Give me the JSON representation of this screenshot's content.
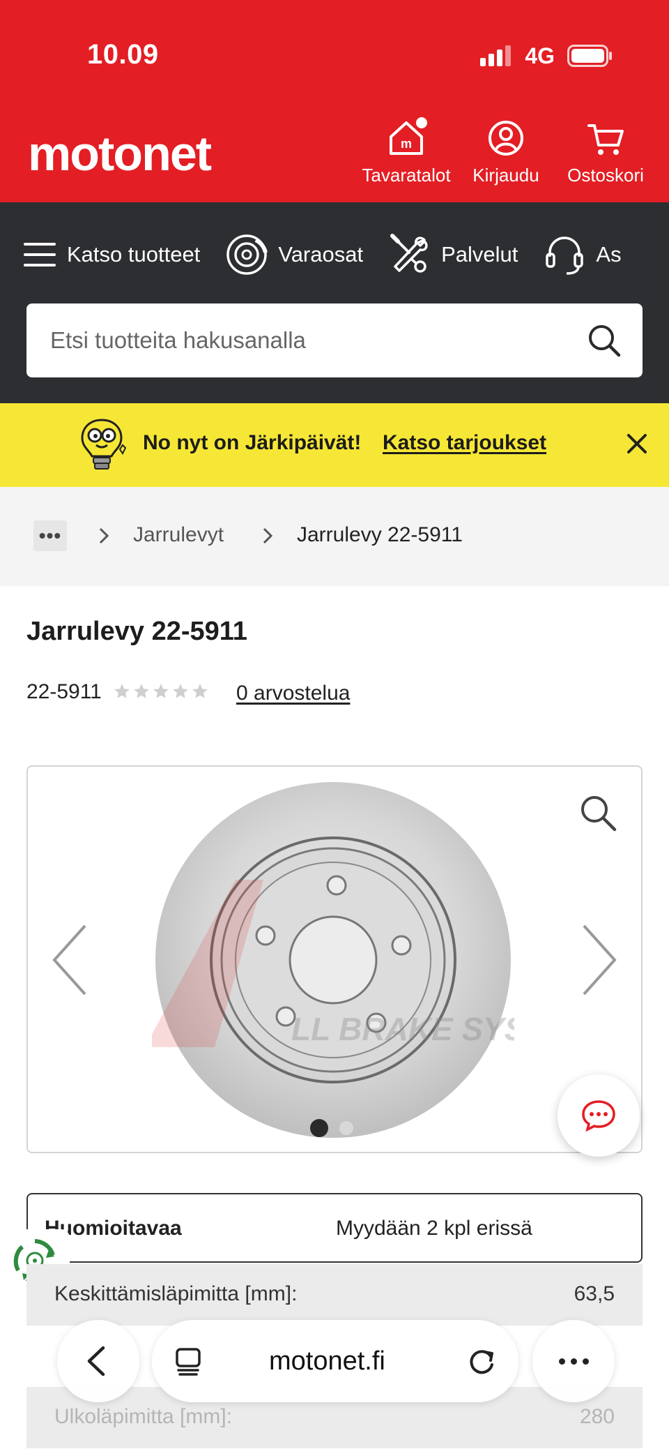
{
  "status": {
    "time": "10.09",
    "network": "4G"
  },
  "header": {
    "logo": "motonet",
    "actions": [
      {
        "label": "Tavaratalot",
        "icon": "store-icon"
      },
      {
        "label": "Kirjaudu",
        "icon": "user-icon"
      },
      {
        "label": "Ostoskori",
        "icon": "cart-icon"
      }
    ]
  },
  "nav": {
    "items": [
      {
        "label": "Katso tuotteet",
        "icon": "menu-icon"
      },
      {
        "label": "Varaosat",
        "icon": "brake-disc-icon"
      },
      {
        "label": "Palvelut",
        "icon": "tools-icon"
      },
      {
        "label": "As",
        "icon": "headset-icon"
      }
    ]
  },
  "search": {
    "placeholder": "Etsi tuotteita hakusanalla"
  },
  "promo": {
    "text": "No nyt on Järkipäivät!",
    "link": "Katso tarjoukset"
  },
  "breadcrumb": {
    "more": "•••",
    "parent": "Jarrulevyt",
    "current": "Jarrulevy 22-5911"
  },
  "product": {
    "title": "Jarrulevy 22-5911",
    "sku": "22-5911",
    "rating": 0,
    "reviews": "0 arvostelua",
    "image_count": 2,
    "active_image": 1
  },
  "notice": {
    "label": "Huomioitavaa",
    "value": "Myydään 2 kpl erissä"
  },
  "specs": [
    {
      "label": "Keskittämisläpimitta [mm]:",
      "value": "63,5"
    },
    {
      "label": "",
      "value": ""
    },
    {
      "label": "Ulkoläpimitta [mm]:",
      "value": "280"
    }
  ],
  "browser": {
    "url": "motonet.fi"
  },
  "colors": {
    "brand_red": "#e31e24",
    "nav_dark": "#2d2e32",
    "promo_yellow": "#f6e736"
  }
}
